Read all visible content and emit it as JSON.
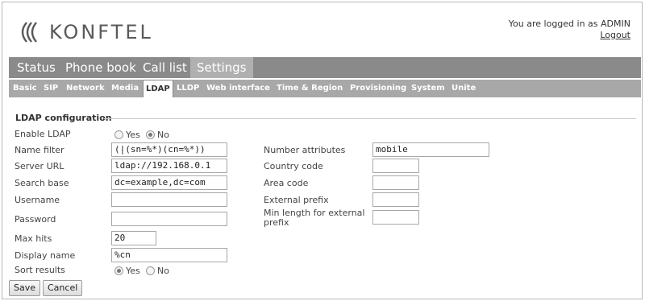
{
  "brand": {
    "logo_text": "KONFTEL",
    "logo_icon": "konftel-wave-icon"
  },
  "header": {
    "login_text": "You are logged in as ADMIN",
    "logout_label": "Logout"
  },
  "main_tabs": [
    {
      "label": "Status"
    },
    {
      "label": "Phone book"
    },
    {
      "label": "Call list"
    },
    {
      "label": "Settings"
    }
  ],
  "main_tabs_active": "Settings",
  "sub_tabs": [
    {
      "label": "Basic"
    },
    {
      "label": "SIP"
    },
    {
      "label": "Network"
    },
    {
      "label": "Media"
    },
    {
      "label": "LDAP"
    },
    {
      "label": "LLDP"
    },
    {
      "label": "Web interface"
    },
    {
      "label": "Time & Region"
    },
    {
      "label": "Provisioning"
    },
    {
      "label": "System"
    },
    {
      "label": "Unite"
    }
  ],
  "sub_tabs_active": "LDAP",
  "form": {
    "section_title": "LDAP configuration",
    "enable_ldap": {
      "label": "Enable LDAP",
      "yes": "Yes",
      "no": "No",
      "selected": "No"
    },
    "name_filter": {
      "label": "Name filter",
      "value": "(|(sn=%*)(cn=%*))"
    },
    "server_url": {
      "label": "Server URL",
      "value": "ldap://192.168.0.1"
    },
    "search_base": {
      "label": "Search base",
      "value": "dc=example,dc=com"
    },
    "username": {
      "label": "Username",
      "value": ""
    },
    "password": {
      "label": "Password",
      "value": ""
    },
    "max_hits": {
      "label": "Max hits",
      "value": "20"
    },
    "display_name": {
      "label": "Display name",
      "value": "%cn"
    },
    "sort_results": {
      "label": "Sort results",
      "yes": "Yes",
      "no": "No",
      "selected": "Yes"
    },
    "number_attributes": {
      "label": "Number attributes",
      "value": "mobile"
    },
    "country_code": {
      "label": "Country code",
      "value": ""
    },
    "area_code": {
      "label": "Area code",
      "value": ""
    },
    "external_prefix": {
      "label": "External prefix",
      "value": ""
    },
    "min_length_external_prefix": {
      "label_line1": "Min length for external",
      "label_line2": "prefix",
      "value": ""
    }
  },
  "buttons": {
    "save": "Save",
    "cancel": "Cancel"
  }
}
